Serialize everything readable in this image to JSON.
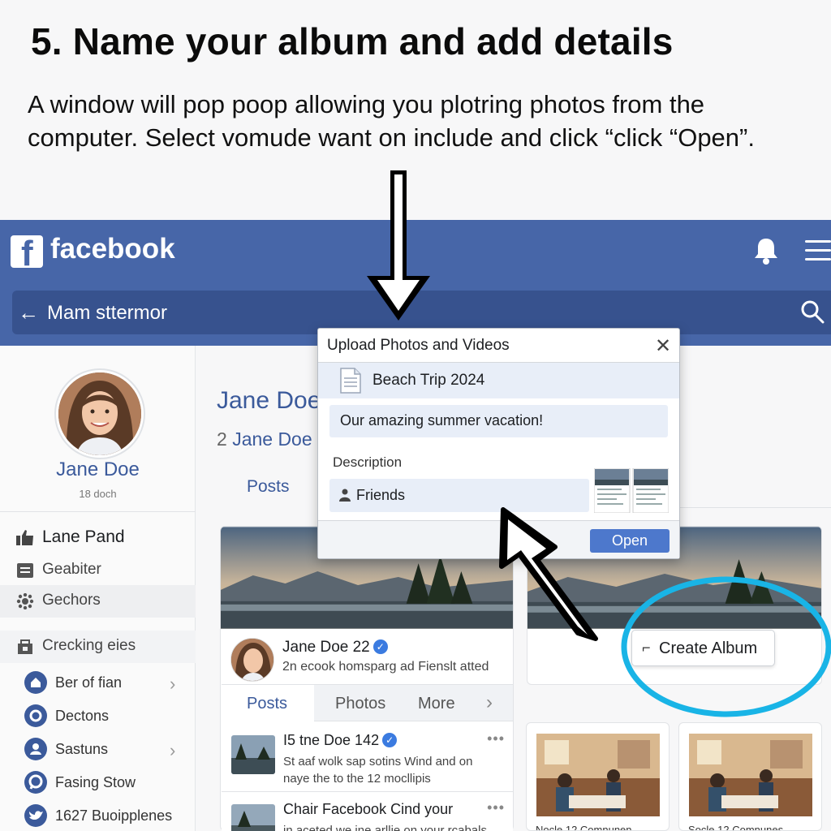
{
  "instruction": {
    "title": "5. Name your album and add details",
    "description": "A window will pop poop allowing you plotring photos from the computer. Select vomude want on include and click “click “Open”."
  },
  "header": {
    "logo_letter": "f",
    "brand": "facebook",
    "back_symbol": "←",
    "search_text": "Mam sttermor"
  },
  "sidebar": {
    "profile_name": "Jane Doe",
    "profile_sub": "18 doch",
    "items": [
      {
        "label": "Lane Pand",
        "icon": "thumbs-up-icon"
      },
      {
        "label": "Geabiter",
        "icon": "list-icon"
      },
      {
        "label": "Gechors",
        "icon": "gear-icon"
      },
      {
        "label": "Crecking eies",
        "icon": "store-icon"
      },
      {
        "label": "Ber of fian",
        "icon": "home-icon"
      },
      {
        "label": "Dectons",
        "icon": "settings-icon"
      },
      {
        "label": "Sastuns",
        "icon": "user-icon"
      },
      {
        "label": "Fasing Stow",
        "icon": "chat-icon"
      },
      {
        "label": "1627 Buoipplenes",
        "icon": "bird-icon"
      }
    ],
    "chevron": "›"
  },
  "main": {
    "name": "Jane Doe",
    "sub_prefix": "2",
    "sub_name": "Jane Doe",
    "posts_label": "Posts",
    "feed": {
      "name": "Jane Doe 22",
      "text": "2n ecook homsparg ad Fienslt atted",
      "verified_symbol": "✓"
    },
    "tabs": [
      {
        "label": "Posts",
        "active": true
      },
      {
        "label": "Photos",
        "active": false
      },
      {
        "label": "More",
        "active": false
      }
    ],
    "tab_chevron": "›",
    "list": [
      {
        "title": "I5 tne Doe 142",
        "text": "St aaf wolk sap sotins Wind and on naye the to the 12 mocllipis",
        "verified": true
      },
      {
        "title": "Chair Facebook Cind your",
        "text": "in aceted we ine arllie on your rcabals",
        "verified": false
      }
    ],
    "more_dots": "•••",
    "create_album": {
      "icon": "⌐",
      "label": "Create Album"
    },
    "photo_captions": [
      "Nocle 12 Comnunen",
      "Socle 12 Comnunes"
    ]
  },
  "dialog": {
    "title": "Upload Photos and Videos",
    "close": "✕",
    "album_name": "Beach Trip 2024",
    "album_desc": "Our amazing summer vacation!",
    "description_label": "Description",
    "privacy": "Friends",
    "open_label": "Open"
  },
  "colors": {
    "facebook_blue": "#4766a8",
    "link_blue": "#3b5a9b",
    "open_button": "#4d78cc",
    "highlight_circle": "#19b4e6"
  }
}
